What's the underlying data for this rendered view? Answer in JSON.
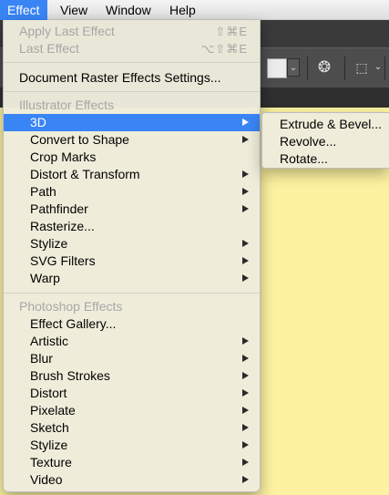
{
  "menubar": {
    "items": [
      {
        "label": "Effect"
      },
      {
        "label": "View"
      },
      {
        "label": "Window"
      },
      {
        "label": "Help"
      }
    ]
  },
  "effect_menu": {
    "apply_last": {
      "label": "Apply Last Effect",
      "shortcut": "⇧⌘E"
    },
    "last_effect": {
      "label": "Last Effect",
      "shortcut": "⌥⇧⌘E"
    },
    "document_raster": {
      "label": "Document Raster Effects Settings..."
    },
    "illustrator_header": "Illustrator Effects",
    "illustrator_items": [
      {
        "label": "3D"
      },
      {
        "label": "Convert to Shape"
      },
      {
        "label": "Crop Marks"
      },
      {
        "label": "Distort & Transform"
      },
      {
        "label": "Path"
      },
      {
        "label": "Pathfinder"
      },
      {
        "label": "Rasterize..."
      },
      {
        "label": "Stylize"
      },
      {
        "label": "SVG Filters"
      },
      {
        "label": "Warp"
      }
    ],
    "photoshop_header": "Photoshop Effects",
    "photoshop_items": [
      {
        "label": "Effect Gallery..."
      },
      {
        "label": "Artistic"
      },
      {
        "label": "Blur"
      },
      {
        "label": "Brush Strokes"
      },
      {
        "label": "Distort"
      },
      {
        "label": "Pixelate"
      },
      {
        "label": "Sketch"
      },
      {
        "label": "Stylize"
      },
      {
        "label": "Texture"
      },
      {
        "label": "Video"
      }
    ]
  },
  "submenu_3d": {
    "items": [
      {
        "label": "Extrude & Bevel..."
      },
      {
        "label": "Revolve..."
      },
      {
        "label": "Rotate..."
      }
    ]
  },
  "colors": {
    "highlight": "#3a85f5",
    "canvas": "#fdf2a0",
    "menu_bg": "#eeecdc"
  }
}
